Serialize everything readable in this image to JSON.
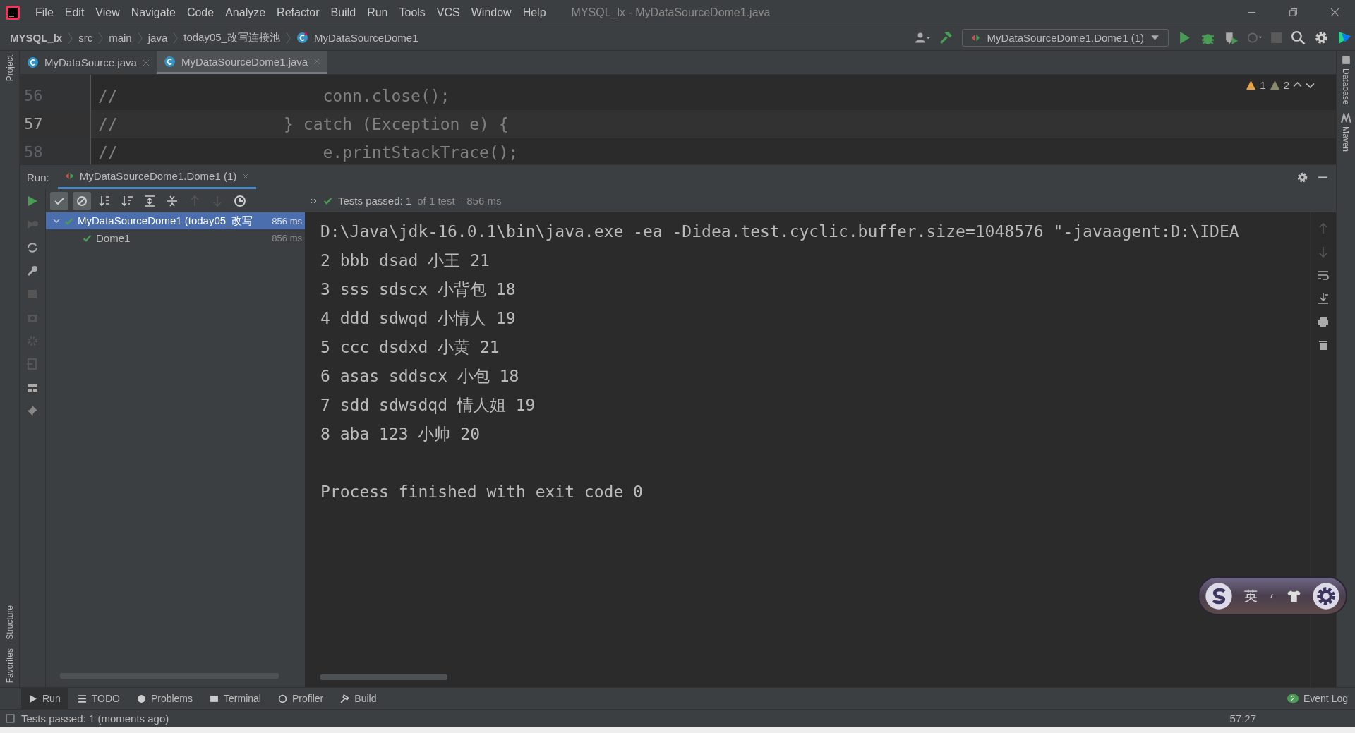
{
  "window": {
    "title": "MYSQL_lx - MyDataSourceDome1.java"
  },
  "menu": [
    "File",
    "Edit",
    "View",
    "Navigate",
    "Code",
    "Analyze",
    "Refactor",
    "Build",
    "Run",
    "Tools",
    "VCS",
    "Window",
    "Help"
  ],
  "breadcrumbs": [
    {
      "label": "MYSQL_lx",
      "kind": "project"
    },
    {
      "label": "src",
      "kind": "folder"
    },
    {
      "label": "main",
      "kind": "folder"
    },
    {
      "label": "java",
      "kind": "folder"
    },
    {
      "label": "today05_改写连接池",
      "kind": "folder"
    },
    {
      "label": "MyDataSourceDome1",
      "kind": "class"
    }
  ],
  "run_config": "MyDataSourceDome1.Dome1 (1)",
  "editor_tabs": [
    {
      "label": "MyDataSource.java",
      "selected": false
    },
    {
      "label": "MyDataSourceDome1.java",
      "selected": true
    }
  ],
  "inspections": {
    "warnings": "1",
    "weak_warnings": "2"
  },
  "editor_lines": [
    {
      "number": "56",
      "code": "//                     conn.close();",
      "current": false
    },
    {
      "number": "57",
      "code": "//                 } catch (Exception e) {",
      "current": true
    },
    {
      "number": "58",
      "code": "//                     e.printStackTrace();",
      "current": false
    }
  ],
  "left_stripe": [
    "Project",
    "Structure",
    "Favorites"
  ],
  "right_stripe": [
    "Database",
    "Maven"
  ],
  "run_panel": {
    "label": "Run:",
    "tab": {
      "label": "MyDataSourceDome1.Dome1 (1)",
      "selected": true
    },
    "status": "Tests passed: 1",
    "status_detail": "of 1 test – 856 ms"
  },
  "test_tree": [
    {
      "label": "MyDataSourceDome1 (today05_改写",
      "time": "856 ms",
      "selected": true,
      "expanded": true,
      "passed": true,
      "children": [
        {
          "label": "Dome1",
          "time": "856 ms",
          "selected": false,
          "passed": true
        }
      ]
    }
  ],
  "console": {
    "lines": [
      "D:\\Java\\jdk-16.0.1\\bin\\java.exe -ea -Didea.test.cyclic.buffer.size=1048576 \"-javaagent:D:\\IDEA",
      "2 bbb dsad 小王 21",
      "3 sss sdscx 小背包 18",
      "4 ddd sdwqd 小情人 19",
      "5 ccc dsdxd 小黄 21",
      "6 asas sddscx 小包 18",
      "7 sdd sdwsdqd 情人姐 19",
      "8 aba 123 小帅 20"
    ],
    "exit_message": "Process finished with exit code 0"
  },
  "ime": {
    "mode": "英"
  },
  "bottom_tools": [
    {
      "label": "Run",
      "selected": true
    },
    {
      "label": "TODO",
      "selected": false
    },
    {
      "label": "Problems",
      "selected": false
    },
    {
      "label": "Terminal",
      "selected": false
    },
    {
      "label": "Profiler",
      "selected": false
    },
    {
      "label": "Build",
      "selected": false
    }
  ],
  "event_log": {
    "label": "Event Log",
    "count": "2"
  },
  "status_bar": {
    "message": "Tests passed: 1 (moments ago)",
    "position": "57:27"
  }
}
